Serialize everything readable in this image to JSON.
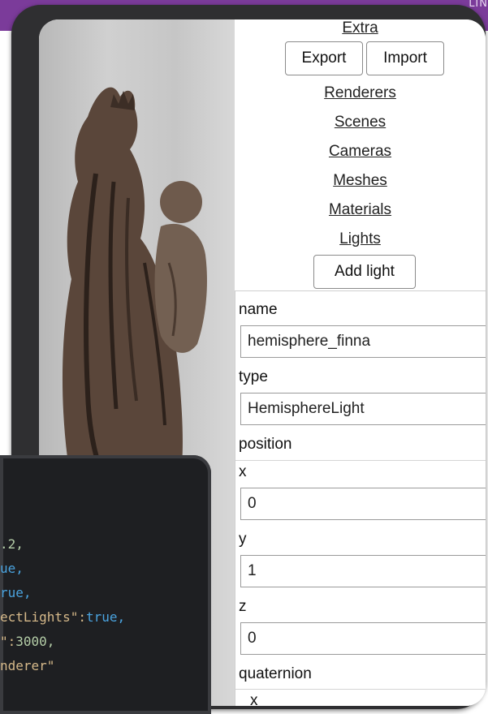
{
  "header": {
    "corner_text": "LIN"
  },
  "panel": {
    "extra_label": "Extra",
    "export_label": "Export",
    "import_label": "Import",
    "nav": [
      "Renderers",
      "Scenes",
      "Cameras",
      "Meshes",
      "Materials",
      "Lights"
    ],
    "add_light_label": "Add light"
  },
  "form": {
    "name_label": "name",
    "name_value": "hemisphere_finna",
    "type_label": "type",
    "type_value": "HemisphereLight",
    "position_label": "position",
    "x_label": "x",
    "x_value": "0",
    "y_label": "y",
    "y_value": "1",
    "z_label": "z",
    "z_value": "0",
    "quaternion_label": "quaternion",
    "qx_label": "x"
  },
  "code_snippet": {
    "l1": ".2,",
    "l2": "ue,",
    "l3": "rue,",
    "l4a": "ectLights\":",
    "l4b": "true,",
    "l5a": "\":",
    "l5b": "3000,",
    "l6": "nderer\""
  },
  "colors": {
    "accent": "#7b3b9a",
    "frame": "#2f2f31",
    "editor_bg": "#1e1f22"
  }
}
